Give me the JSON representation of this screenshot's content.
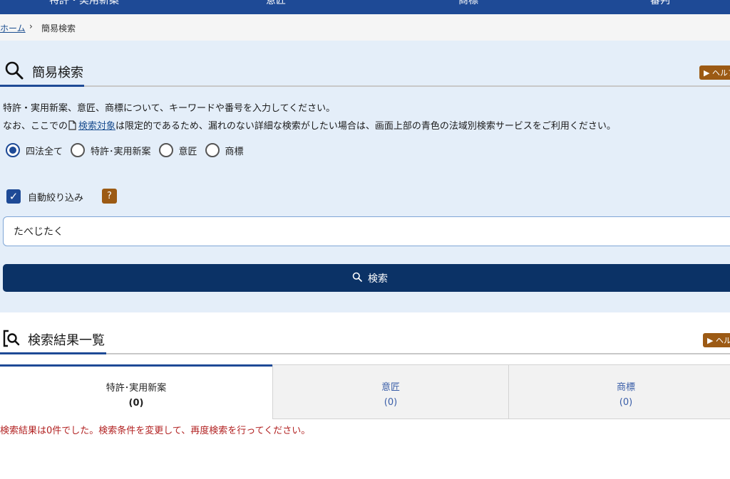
{
  "topnav": {
    "items": [
      "特許・実用新案",
      "意匠",
      "商標",
      "審判"
    ]
  },
  "breadcrumb": {
    "home": "ホーム",
    "separator": "›",
    "current": "簡易検索"
  },
  "search": {
    "title": "簡易検索",
    "help": "▶ ヘルプ",
    "desc1": "特許・実用新案、意匠、商標について、キーワードや番号を入力してください。",
    "desc2_before": "なお、ここでの",
    "desc2_link": "検索対象",
    "desc2_after": "は限定的であるため、漏れのない詳細な検索がしたい場合は、画面上部の青色の法域別検索サービスをご利用ください。",
    "radios": [
      {
        "label": "四法全て",
        "checked": true
      },
      {
        "label": "特許･実用新案",
        "checked": false
      },
      {
        "label": "意匠",
        "checked": false
      },
      {
        "label": "商標",
        "checked": false
      }
    ],
    "auto_filter_label": "自動絞り込み",
    "auto_filter_checked": true,
    "question_mark": "?",
    "keyword_value": "たべじたく",
    "button_label": "検索"
  },
  "results": {
    "title": "検索結果一覧",
    "help": "▶ ヘルプ",
    "tabs": [
      {
        "label": "特許･実用新案",
        "count": "(0)"
      },
      {
        "label": "意匠",
        "count": "(0)"
      },
      {
        "label": "商標",
        "count": "(0)"
      }
    ],
    "message": "検索結果は0件でした。検索条件を変更して、再度検索を行ってください。"
  },
  "colors": {
    "nav_blue": "#1e4a96",
    "button_navy": "#0b3266",
    "help_brown": "#9c5a14",
    "panel_bg": "#e4eef9",
    "error_red": "#b22222"
  }
}
